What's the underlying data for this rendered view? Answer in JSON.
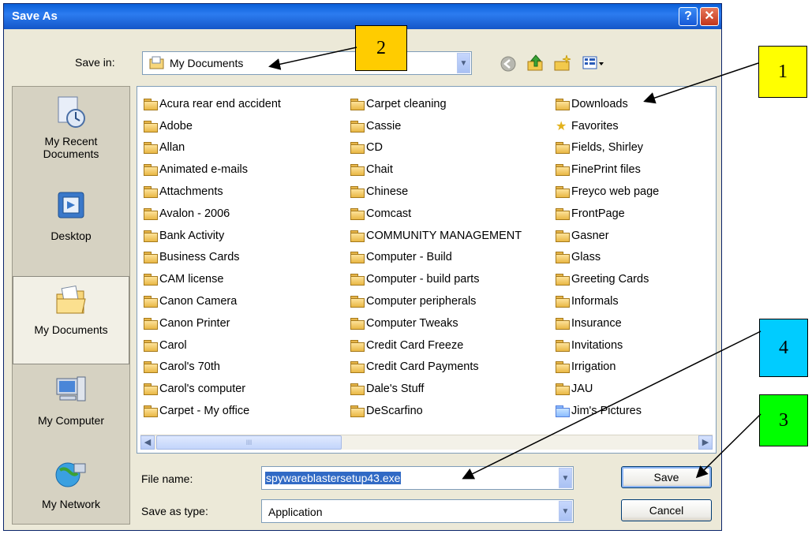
{
  "dialog": {
    "title": "Save As",
    "help_glyph": "?",
    "close_glyph": "✕"
  },
  "toolbar": {
    "save_in_label": "Save in:",
    "save_in_value": "My Documents",
    "icons": [
      "back-icon",
      "up-folder-icon",
      "new-folder-icon",
      "views-menu-icon"
    ]
  },
  "places": [
    {
      "label_lines": [
        "My Recent",
        "Documents"
      ],
      "icon": "recent-documents-icon"
    },
    {
      "label_lines": [
        "Desktop"
      ],
      "icon": "desktop-icon"
    },
    {
      "label_lines": [
        "My Documents"
      ],
      "icon": "my-documents-icon",
      "selected": true
    },
    {
      "label_lines": [
        "My Computer"
      ],
      "icon": "my-computer-icon"
    },
    {
      "label_lines": [
        "My Network"
      ],
      "icon": "my-network-icon"
    }
  ],
  "files": {
    "col1": [
      "Acura rear end accident",
      "Adobe",
      "Allan",
      "Animated e-mails",
      "Attachments",
      "Avalon - 2006",
      "Bank Activity",
      "Business Cards",
      "CAM license",
      "Canon Camera",
      "Canon Printer",
      "Carol",
      "Carol's 70th",
      "Carol's computer",
      "Carpet - My office"
    ],
    "col2": [
      "Carpet cleaning",
      "Cassie",
      "CD",
      "Chait",
      "Chinese",
      "Comcast",
      "COMMUNITY MANAGEMENT",
      "Computer - Build",
      "Computer - build parts",
      "Computer peripherals",
      "Computer Tweaks",
      "Credit Card Freeze",
      "Credit Card Payments",
      "Dale's Stuff",
      "DeScarfino"
    ],
    "col3": [
      "Downloads",
      "Favorites",
      "Fields, Shirley",
      "FinePrint files",
      "Freyco web page",
      "FrontPage",
      "Gasner",
      "Glass",
      "Greeting Cards",
      "Informals",
      "Insurance",
      "Invitations",
      "Irrigation",
      "JAU",
      "Jim's Pictures"
    ]
  },
  "form": {
    "file_name_label": "File name:",
    "file_name_value": "spywareblastersetup43.exe",
    "save_type_label": "Save as type:",
    "save_type_value": "Application",
    "save_button": "Save",
    "cancel_button": "Cancel"
  },
  "callouts": [
    {
      "label": "1",
      "color": "#ffff00"
    },
    {
      "label": "2",
      "color": "#ffcc00"
    },
    {
      "label": "3",
      "color": "#00ff00"
    },
    {
      "label": "4",
      "color": "#00ccff"
    }
  ],
  "scrollbar": {
    "left_glyph": "◀",
    "right_glyph": "▶",
    "grip": "III"
  }
}
